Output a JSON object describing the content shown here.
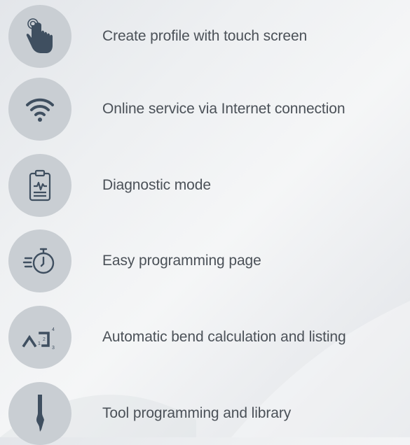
{
  "features": [
    {
      "label": "Create profile with touch screen",
      "icon": "touch-hand-icon"
    },
    {
      "label": "Online service via Internet connection",
      "icon": "wifi-icon"
    },
    {
      "label": "Diagnostic mode",
      "icon": "clipboard-pulse-icon"
    },
    {
      "label": "Easy programming page",
      "icon": "stopwatch-icon"
    },
    {
      "label": "Automatic bend calculation and listing",
      "icon": "bend-sequence-icon"
    },
    {
      "label": "Tool programming and library",
      "icon": "press-tool-icon"
    }
  ],
  "colors": {
    "icon_circle": "#c9ced3",
    "icon_fill": "#3f4f60",
    "text": "#4b5158",
    "background": "#eef0f2"
  }
}
